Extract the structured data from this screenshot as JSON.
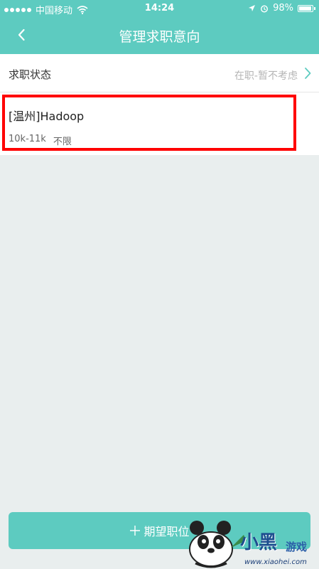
{
  "status_bar": {
    "carrier": "中国移动",
    "time": "14:24",
    "battery_text": "98%",
    "battery_level": 0.98
  },
  "nav": {
    "title": "管理求职意向"
  },
  "job_status": {
    "label": "求职状态",
    "value": "在职-暂不考虑"
  },
  "intentions": [
    {
      "title": "[温州]Hadoop",
      "salary": "10k-11k",
      "extra": "不限"
    }
  ],
  "add_button": {
    "label": "期望职位"
  },
  "watermark": {
    "name": "小黑",
    "game": "游戏",
    "url": "www.xiaohei.com"
  },
  "colors": {
    "accent": "#5dcbc0",
    "highlight": "#ff0000"
  }
}
